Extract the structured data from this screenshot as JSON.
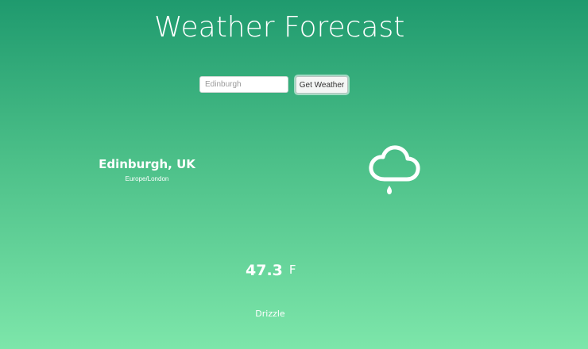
{
  "app": {
    "title": "Weather Forecast"
  },
  "search": {
    "value": "",
    "placeholder": "Edinburgh",
    "button_label": "Get Weather"
  },
  "location": {
    "name": "Edinburgh, UK",
    "timezone": "Europe/London"
  },
  "weather": {
    "icon": "cloud-drizzle-icon",
    "temperature": "47.3",
    "unit": "F",
    "condition": "Drizzle"
  },
  "colors": {
    "background_top": "#1f9a6e",
    "background_bottom": "#7de6aa",
    "text": "#ffffff"
  }
}
